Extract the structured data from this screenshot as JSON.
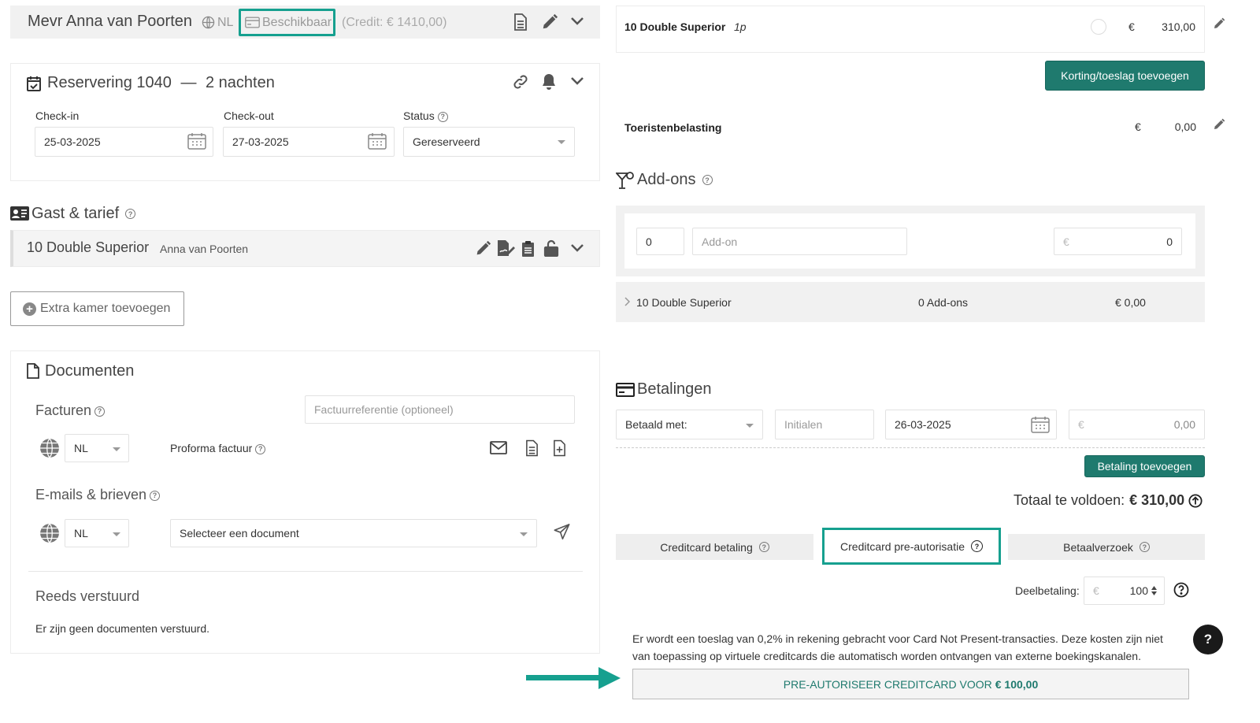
{
  "guest_header": {
    "name": "Mevr Anna van Poorten",
    "lang": "NL",
    "availability": "Beschikbaar",
    "credit": "(Credit: € 1410,00)"
  },
  "reservation": {
    "title": "Reservering 1040",
    "dash": "—",
    "nights": "2 nachten",
    "checkin_label": "Check-in",
    "checkin_value": "25-03-2025",
    "checkout_label": "Check-out",
    "checkout_value": "27-03-2025",
    "status_label": "Status",
    "status_value": "Gereserveerd"
  },
  "guest_rate": {
    "title": "Gast & tarief",
    "room": "10 Double Superior",
    "guest": "Anna van Poorten",
    "add_room": "Extra kamer toevoegen"
  },
  "documents": {
    "title": "Documenten",
    "invoices_label": "Facturen",
    "invoice_ref_placeholder": "Factuurreferentie (optioneel)",
    "invoice_lang": "NL",
    "proforma_label": "Proforma factuur",
    "emails_label": "E-mails & brieven",
    "email_lang": "NL",
    "select_doc": "Selecteer een document",
    "sent_label": "Reeds verstuurd",
    "sent_none": "Er zijn geen documenten verstuurd."
  },
  "room_line": {
    "name": "10 Double Superior",
    "persons": "1p",
    "currency": "€",
    "amount": "310,00"
  },
  "discount_button": "Korting/toeslag toevoegen",
  "tourist_tax": {
    "label": "Toeristenbelasting",
    "currency": "€",
    "amount": "0,00"
  },
  "addons": {
    "title": "Add-ons",
    "qty": "0",
    "name_placeholder": "Add-on",
    "currency": "€",
    "price": "0",
    "summary_room": "10 Double Superior",
    "summary_count": "0 Add-ons",
    "summary_total": "€ 0,00"
  },
  "payments": {
    "title": "Betalingen",
    "paid_with": "Betaald met:",
    "initials_placeholder": "Initialen",
    "date": "26-03-2025",
    "currency": "€",
    "amount": "0,00",
    "add_button": "Betaling toevoegen",
    "total_label": "Totaal te voldoen:",
    "total_value": "€ 310,00"
  },
  "cc_tabs": {
    "tab1": "Creditcard betaling",
    "tab2": "Creditcard pre-autorisatie",
    "tab3": "Betaalverzoek"
  },
  "preauth": {
    "partial_label": "Deelbetaling:",
    "currency": "€",
    "partial_value": "100",
    "notice": "Er wordt een toeslag van 0,2% in rekening gebracht voor Card Not Present-transacties. Deze kosten zijn niet van toepassing op virtuele creditcards die automatisch worden ontvangen van externe boekingskanalen.",
    "button_prefix": "PRE-AUTORISEER CREDITCARD VOOR",
    "button_amount": "€ 100,00"
  },
  "help_button": "?",
  "colors": {
    "teal": "#1f7a6e",
    "highlight": "#16a08f"
  }
}
